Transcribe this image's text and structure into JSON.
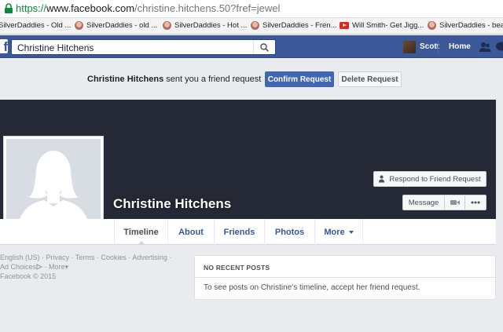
{
  "browser": {
    "url_scheme": "https://",
    "url_host": "www.facebook.com",
    "url_path": "/christine.hitchens.50?fref=jewel",
    "bookmarks": [
      {
        "label": "SilverDaddies - Old ...",
        "icon": "favicon-icon"
      },
      {
        "label": "SilverDaddies - old ...",
        "icon": "favicon-icon"
      },
      {
        "label": "SilverDaddies - Hot ...",
        "icon": "favicon-icon"
      },
      {
        "label": "SilverDaddies - Fren...",
        "icon": "favicon-icon"
      },
      {
        "label": "Will Smith- Get Jigg...",
        "icon": "youtube-icon"
      },
      {
        "label": "SilverDaddies - beat",
        "icon": "favicon-icon"
      }
    ]
  },
  "topbar": {
    "logo": "f",
    "search_value": "Christine Hitchens",
    "user_name": "Scott",
    "home_label": "Home",
    "brand_color": "#3b5998"
  },
  "request": {
    "sender": "Christine Hitchens",
    "message": "sent you a friend request",
    "confirm_label": "Confirm Request",
    "delete_label": "Delete Request"
  },
  "profile": {
    "name": "Christine Hitchens",
    "respond_label": "Respond to Friend Request",
    "message_label": "Message",
    "tabs": [
      "Timeline",
      "About",
      "Friends",
      "Photos",
      "More"
    ],
    "active_tab": "Timeline"
  },
  "footer": {
    "line1": [
      "English (US)",
      "Privacy",
      "Terms",
      "Cookies",
      "Advertising"
    ],
    "line2": [
      "Ad Choices",
      "More"
    ],
    "copyright": "Facebook © 2015"
  },
  "posts": {
    "heading": "NO RECENT POSTS",
    "body": "To see posts on Christine's timeline, accept her friend request."
  }
}
